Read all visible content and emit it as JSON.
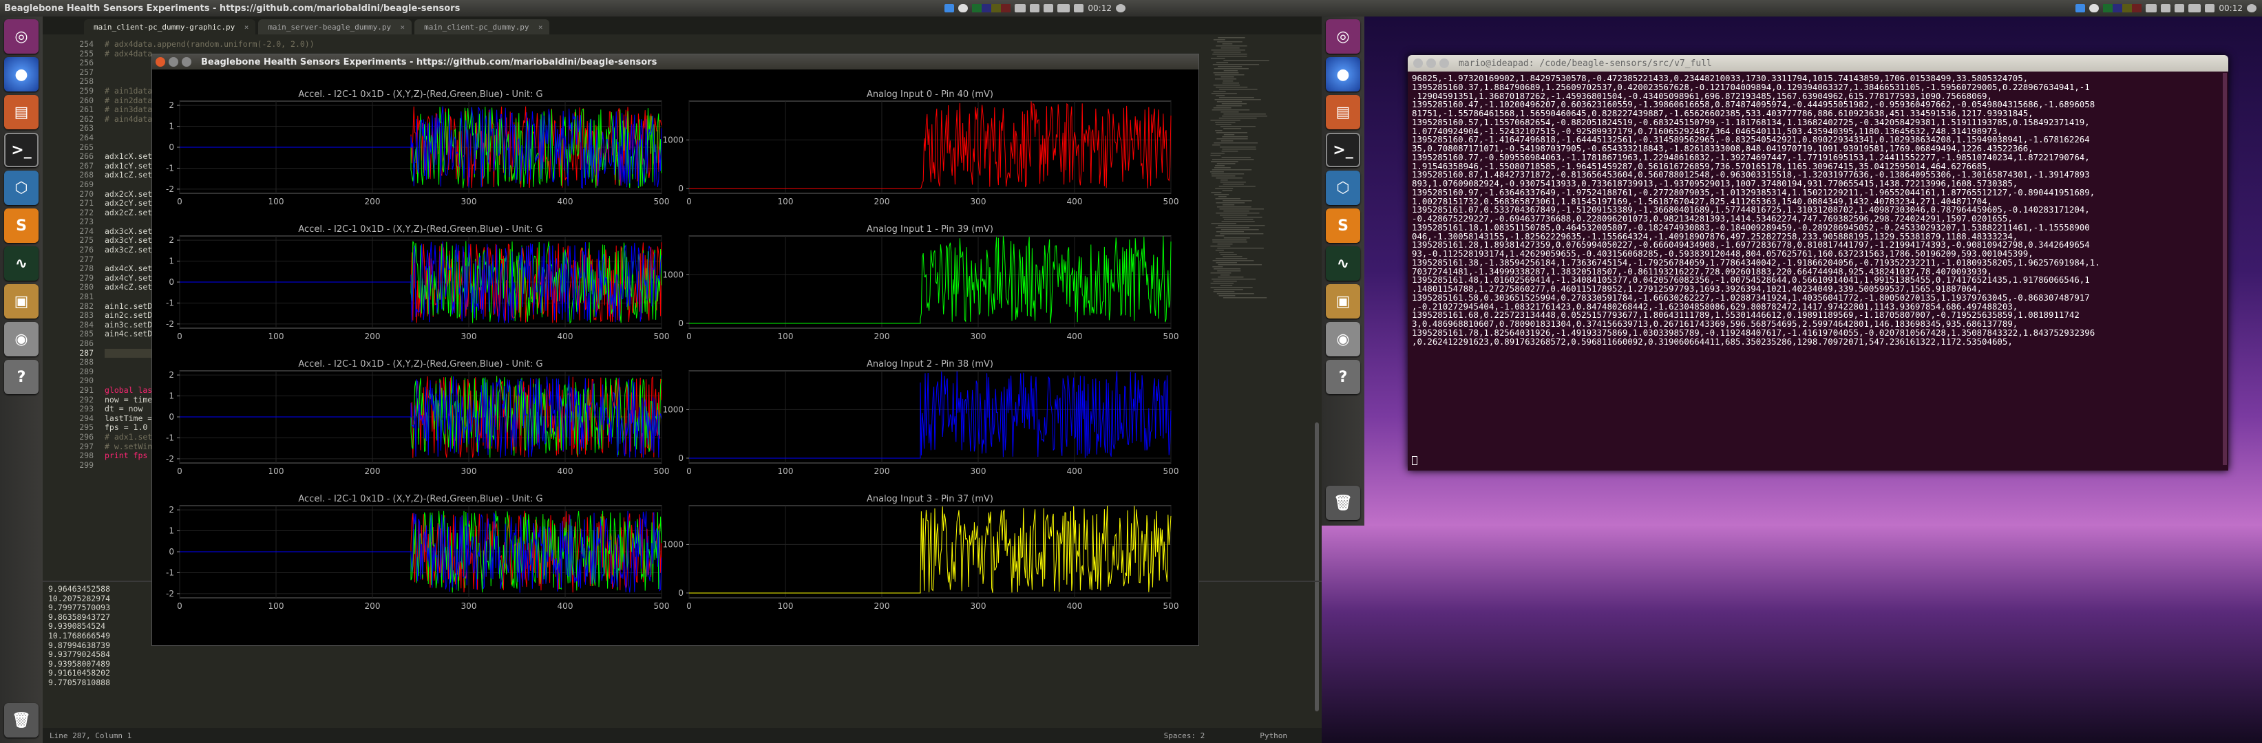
{
  "left": {
    "topbar_title": "Beaglebone Health Sensors Experiments - https://github.com/mariobaldini/beagle-sensors",
    "clock": "00:12",
    "editor": {
      "tabs": [
        {
          "label": "main_client-pc_dummy-graphic.py",
          "active": true
        },
        {
          "label": "main_server-beagle_dummy.py",
          "active": false
        },
        {
          "label": "main_client-pc_dummy.py",
          "active": false
        }
      ],
      "line_numbers": [
        "254",
        "255",
        "256",
        "257",
        "258",
        "259",
        "260",
        "261",
        "262",
        "263",
        "264",
        "265",
        "266",
        "267",
        "268",
        "269",
        "270",
        "271",
        "272",
        "273",
        "274",
        "275",
        "276",
        "277",
        "278",
        "279",
        "280",
        "281",
        "282",
        "283",
        "284",
        "285",
        "286",
        "287",
        "288",
        "289",
        "290",
        "291",
        "292",
        "293",
        "294",
        "295",
        "296",
        "297",
        "298",
        "299"
      ],
      "code_lines": [
        "# adx4data.append(random.uniform(-2.0, 2.0))",
        "# adx4data",
        "",
        "",
        "",
        "# ain1data",
        "# ain2data",
        "# ain3data",
        "# ain4data",
        "",
        "",
        "",
        "adx1cX.set",
        "adx1cY.set",
        "adx1cZ.set",
        "",
        "adx2cX.set",
        "adx2cY.set",
        "adx2cZ.set",
        "",
        "adx3cX.set",
        "adx3cY.set",
        "adx3cZ.set",
        "",
        "adx4cX.set",
        "adx4cY.set",
        "adx4cZ.set",
        "",
        "ain1c.setD",
        "ain2c.setD",
        "ain3c.setD",
        "ain4c.setD",
        "",
        "",
        "",
        "",
        "",
        "global las",
        "now = time",
        "dt = now",
        "lastTime =",
        "fps = 1.0",
        "# adx1.set",
        "# w.setWin",
        "print fps",
        ""
      ],
      "console_lines": [
        "9.96463452588",
        "10.2075282974",
        "9.79977570093",
        "9.86358943727",
        "9.9390854524",
        "10.1768666549",
        "9.87994638739",
        "9.93779024584",
        "9.93958007489",
        "9.91610458202",
        "9.77057810888"
      ],
      "status_left": "Line 287, Column 1",
      "status_spaces": "Spaces: 2",
      "status_lang": "Python"
    },
    "plot_window": {
      "title": "Beaglebone Health Sensors Experiments - https://github.com/mariobaldini/beagle-sensors",
      "accel_plots": [
        {
          "title": "Accel. - I2C-1 0x1D - (X,Y,Z)-(Red,Green,Blue) - Unit: G"
        },
        {
          "title": "Accel. - I2C-1 0x1D - (X,Y,Z)-(Red,Green,Blue) - Unit: G"
        },
        {
          "title": "Accel. - I2C-1 0x1D - (X,Y,Z)-(Red,Green,Blue) - Unit: G"
        },
        {
          "title": "Accel. - I2C-1 0x1D - (X,Y,Z)-(Red,Green,Blue) - Unit: G"
        }
      ],
      "analog_plots": [
        {
          "title": "Analog Input 0 - Pin 40 (mV)",
          "color": "#ff0000"
        },
        {
          "title": "Analog Input 1 - Pin 39 (mV)",
          "color": "#00ff00"
        },
        {
          "title": "Analog Input 2 - Pin 38 (mV)",
          "color": "#0000ff"
        },
        {
          "title": "Analog Input 3 - Pin 37 (mV)",
          "color": "#ffff00"
        }
      ],
      "accel_yticks": [
        "2",
        "1",
        "0",
        "-1",
        "-2"
      ],
      "analog_yticks": [
        "1000",
        "0"
      ],
      "xticks": [
        "0",
        "100",
        "200",
        "300",
        "400",
        "500"
      ],
      "accel_colors": [
        "#ff0000",
        "#00ff00",
        "#0000ff"
      ],
      "xlim": [
        0,
        500
      ],
      "accel_ylim": [
        -2.2,
        2.2
      ],
      "analog_ylim": [
        -100,
        1800
      ],
      "data_start": 240
    }
  },
  "right": {
    "clock": "00:12",
    "terminal": {
      "title": "mario@ideapad: /code/beagle-sensors/src/v7_full",
      "lines": [
        "96825,-1.97320169902,1.84297530578,-0.472385221433,0.23448210033,1730.3311794,1015.74143859,1706.01538499,33.5805324705,",
        "1395285160.37,1.884790689,1.25609702537,0.420023567628,-0.121704009894,0.129394063327,1.38466531105,-1.59560729005,0.228967634941,-1",
        ".12904591351,1.36870187262,-1.45936801504,-0.43405098961,696.872193485,1567.63904962,615.778177593,1090.75668069,",
        "1395285160.47,-1.10200496207,0.603623160559,-1.39860616658,0.874874095974,-0.444955051982,-0.959360497662,-0.0549804315686,-1.6896058",
        "81751,-1.55786461568,1.56590460645,0.828227439887,-1.65626602385,533.403777786,886.610923638,451.334591536,1217.93931845,",
        "1395285160.57,1.15570682654,-0.882051824519,-0.683245150799,-1.181768134,1.13682402725,-0.342058429381,1.51911193785,0.158492371419,",
        "1.07740924904,-1.52432107515,-0.92589937179,0.716065292487,364.046540111,503.435940395,1180.13645632,748.314198973,",
        "1395285160.67,-1.41647496818,-1.64445132561,-0.314589562965,-0.832540542921,0.890229343341,0.102938634208,1.15949038941,-1.678162264",
        "35,0.708087171071,-0.541987037905,-0.654333218843,-1.82618333008,848.041970719,1091.93919581,1769.06849494,1226.43522366,",
        "1395285160.77,-0.509556984063,-1.17818671963,1.22948616832,-1.39274697447,-1.77191695153,1.24411552277,-1.98510740234,1.87221790764,",
        "1.91546358946,-1.55080718585,-1.96451459287,0.561616726859,736.570165178,1165.30967415,35.0412595014,464.6276685,",
        "1395285160.87,1.48427371872,-0.813656453604,0.560788012548,-0.963003315518,-1.32031977636,-0.138640955306,-1.30165874301,-1.39147893",
        "893,1.07609082924,-0.93075413933,0.733618739913,-1.93709529013,1007.37480194,931.770655415,1438.72213996,1608.5730385,",
        "1395285160.97,-1.63646337649,-1.97524188761,-0.27728079035,-1.01329385314,1.15021229211,-1.96552044161,1.87765512127,-0.890441951689,",
        "1.00278151732,0.568365873061,1.81545197169,-1.56187670427,825.411265363,1540.0884349,1432.40783234,271.404871704,",
        "1395285161.07,0.533704367849,-1.51209153389,-1.36680401689,1.57744816725,1.31031208702,1.40987303046,0.787964459605,-0.140283171204,",
        "-0.428675229227,-0.694637736688,0.228096201073,0.982134281393,1414.53462274,747.769382596,298.724024291,1597.0201655,",
        "1395285161.18,1.08351150785,0.464532005807,-0.182474930883,-0.184009289459,-0.289286945052,-0.245330293207,1.53882211461,-1.15558900",
        "046,-1.30058143155,-1.82562229635,-1.155664324,-1.40918907876,497.252827258,233.905888195,1329.55381879,1188.48333234,",
        "1395285161.28,1.89381427359,0.0765994050227,-0.666049434908,-1.69772836778,0.810817441797,-1.21994174393,-0.90810942798,0.3442649654",
        "93,-0.112528193174,1.42629059655,-0.403156068285,-0.593839120448,804.057625761,160.637231563,1786.50196209,593.001045399,",
        "1395285161.38,-1.38594256184,1.73636745154,-1.79256784059,1.77864340042,-1.91866204056,-0.719352232211,-1.01809358205,1.96257691984,1.",
        "70372741481,-1.34999338287,1.38320518507,-0.861193216227,728.092601883,220.664744948,925.438241037,78.4070093939,",
        "1395285161.48,1.01602569414,-1.34084105377,0.0420576082356,-1.00754528644,0.56610914041,1.99151385455,0.174176521435,1.91786066546,1",
        ".14801154788,1.27275860277,0.460115178952,1.27912597793,1693.3926394,1021.40234049,339.500599537,1565.91887064,",
        "1395285161.58,0.303651525994,0.278330591784,-1.66630262227,-1.02887341924,1.40356041772,-1.80050270135,1.19379763045,-0.868307487917",
        ",-0.210272945404,-1.08321761423,0.847480268442,-1.62304858086,629.808782472,1417.97422801,1143.93697854,686.497488203,",
        "1395285161.68,0.225723134448,0.0525157793677,1.80643111789,1.55301446612,0.19891189569,-1.18705807007,-0.719525635859,1.0818911742",
        "3,0.486968810607,0.780901831304,0.374156639713,0.267161743369,596.568754695,2.59974642801,146.183698345,935.686137789,",
        "1395285161.78,1.82564031926,-1.49193375869,1.03033985789,-0.119248407617,-1.41619704055,-0.0207810567428,1.35087843322,1.843752932396",
        ",0.262412291623,0.891763268572,0.596811660092,0.319060664411,685.350235286,1298.70972071,547.236161322,1172.53504605,"
      ]
    }
  }
}
